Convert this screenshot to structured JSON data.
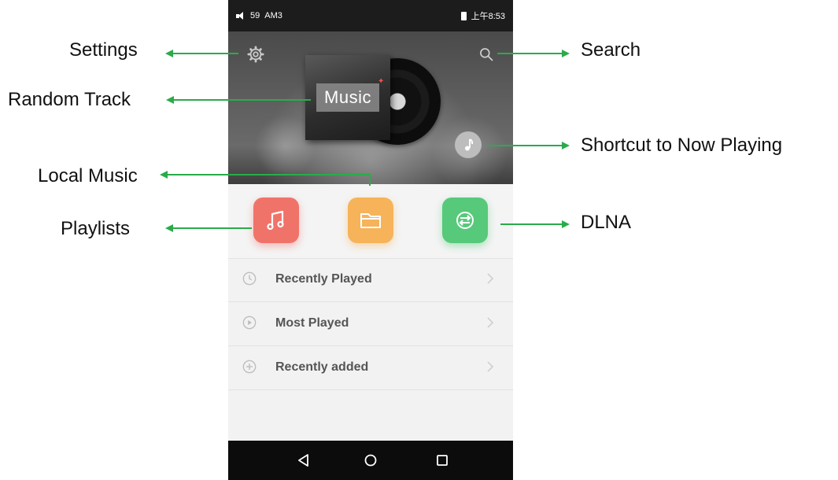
{
  "status_bar": {
    "signal_text": "59",
    "carrier": "AM3",
    "time": "上午8:53"
  },
  "hero": {
    "album_text": "Music"
  },
  "quick_actions": [
    {
      "name": "Playlists",
      "color": "#f0736a",
      "icon": "music-note-icon"
    },
    {
      "name": "Local Music",
      "color": "#f6b35a",
      "icon": "folder-icon"
    },
    {
      "name": "DLNA",
      "color": "#57c97a",
      "icon": "dlna-icon"
    }
  ],
  "list": [
    {
      "label": "Recently Played",
      "icon": "clock-icon"
    },
    {
      "label": "Most Played",
      "icon": "play-circle-icon"
    },
    {
      "label": "Recently added",
      "icon": "plus-circle-icon"
    }
  ],
  "callouts": {
    "settings": "Settings",
    "random_track": "Random Track",
    "local_music": "Local Music",
    "playlists": "Playlists",
    "search": "Search",
    "now_playing": "Shortcut to Now Playing",
    "dlna": "DLNA"
  },
  "colors": {
    "arrow": "#2bab4a",
    "status_bar": "#1c1c1c",
    "nav_bar": "#0c0c0c"
  }
}
